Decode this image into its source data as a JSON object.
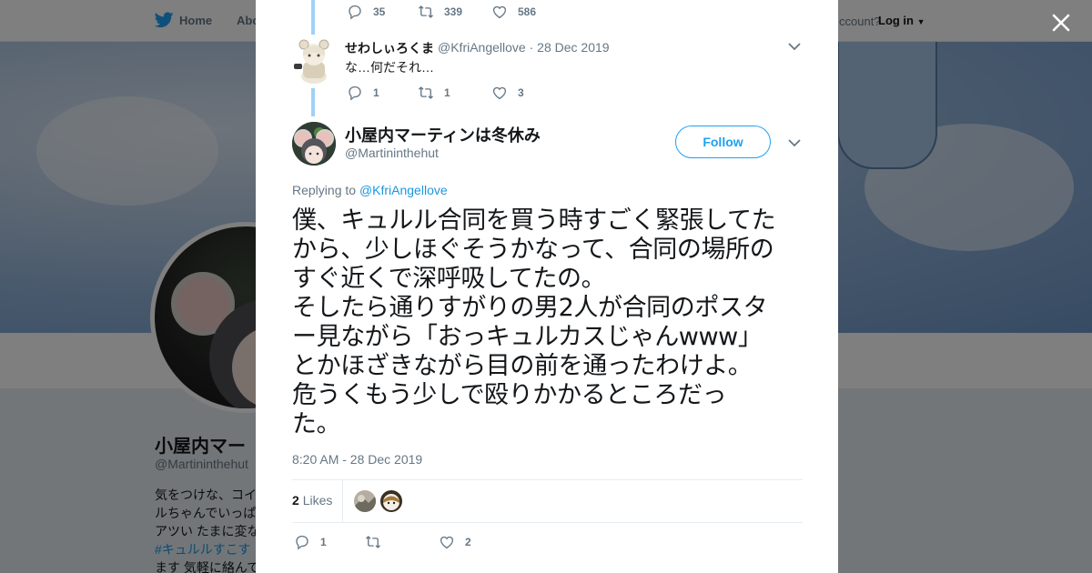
{
  "background_page": {
    "nav": {
      "home": "Home",
      "about": "Abo"
    },
    "account_prompt": "ccount?",
    "login_label": "Log in",
    "profile_name": "小屋内マー",
    "profile_handle": "@Martininthehut",
    "bio_lines": [
      "気をつけな、コイ",
      "ルちゃんでいっぱ",
      "アツい たまに変な",
      "#キュルルすこす",
      "ます 気軽に絡んで"
    ]
  },
  "reply_thread": {
    "previous_actions": {
      "replies": "35",
      "retweets": "339",
      "likes": "586"
    },
    "reply": {
      "name": "せわしぃろくま",
      "handle": "@KfriAngellove",
      "date": "28 Dec 2019",
      "separator": "·",
      "text": "な…何だそれ…",
      "replies": "1",
      "retweets": "1",
      "likes": "3"
    }
  },
  "main_tweet": {
    "name": "小屋内マーティンは冬休み",
    "handle": "@Martininthehut",
    "follow_label": "Follow",
    "replying_prefix": "Replying to",
    "replying_to": "@KfriAngellove",
    "text": "僕、キュルル合同を買う時すごく緊張してた\nから、少しほぐそうかなって、合同の場所の\nすぐ近くで深呼吸してたの。\nそしたら通りすがりの男2人が合同のポスタ\nー見ながら「おっキュルカスじゃんwww」\nとかほざきながら目の前を通ったわけよ。\n危うくもう少しで殴りかかるところだっ\nた。",
    "timestamp": "8:20 AM - 28 Dec 2019",
    "likes_count": "2",
    "likes_label": "Likes",
    "actions": {
      "replies": "1",
      "retweets": "",
      "likes": "2"
    }
  },
  "colors": {
    "accent": "#1da1f2",
    "link": "#1b95e0",
    "thread_line": "#9dd1f7",
    "muted": "#657786",
    "text": "#14171a",
    "border": "#e6ecf0"
  },
  "icons": [
    "twitter-bird-icon",
    "close-icon",
    "reply-icon",
    "retweet-icon",
    "like-icon",
    "chevron-down-icon",
    "dropdown-caret-icon"
  ]
}
